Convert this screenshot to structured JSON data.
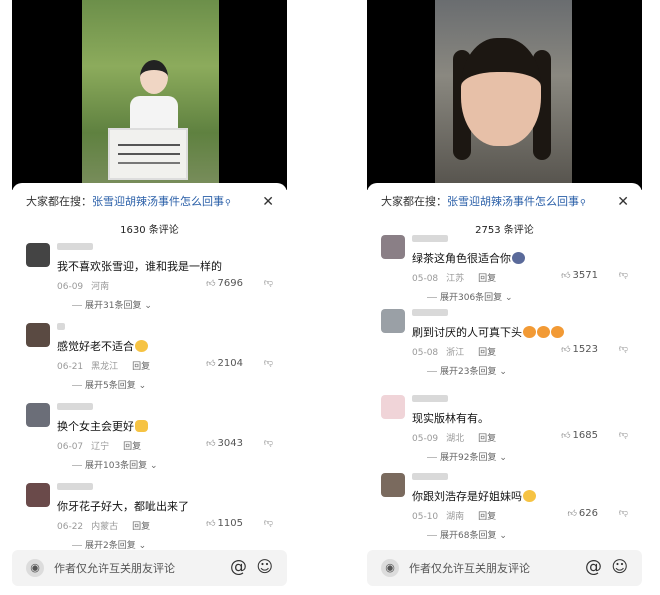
{
  "panels": [
    {
      "search_prefix": "大家都在搜：",
      "search_topic": "张雪迎胡辣汤事件怎么回事",
      "comment_count": "1630 条评论",
      "input_placeholder": "作者仅允许互关朋友评论",
      "comments": [
        {
          "text": "我不喜欢张雪迎，谁和我是一样的",
          "date": "06-09",
          "region": "河南",
          "reply": "",
          "likes": "7696",
          "expand": "展开31条回复",
          "avatar_color": "#444444"
        },
        {
          "text": "感觉好老不适合",
          "date": "06-21",
          "region": "黑龙江",
          "reply": "回复",
          "likes": "2104",
          "expand": "展开5条回复",
          "avatar_color": "#5a4a42"
        },
        {
          "text": "换个女主会更好",
          "date": "06-07",
          "region": "辽宁",
          "reply": "回复",
          "likes": "3043",
          "expand": "展开103条回复",
          "avatar_color": "#6b6e78"
        },
        {
          "text": "你牙花子好大，都呲出来了",
          "date": "06-22",
          "region": "内蒙古",
          "reply": "回复",
          "likes": "1105",
          "expand": "展开2条回复",
          "avatar_color": "#6a4a4a"
        }
      ]
    },
    {
      "search_prefix": "大家都在搜：",
      "search_topic": "张雪迎胡辣汤事件怎么回事",
      "comment_count": "2753 条评论",
      "input_placeholder": "作者仅允许互关朋友评论",
      "comments": [
        {
          "text": "绿茶这角色很适合你",
          "date": "05-08",
          "region": "江苏",
          "reply": "回复",
          "likes": "3571",
          "expand": "展开306条回复",
          "avatar_color": "#8a7f86"
        },
        {
          "text": "刷到讨厌的人可真下头",
          "date": "05-08",
          "region": "浙江",
          "reply": "回复",
          "likes": "1523",
          "expand": "展开23条回复",
          "avatar_color": "#9aa0a6"
        },
        {
          "text": "现实版林有有。",
          "date": "05-09",
          "region": "湖北",
          "reply": "回复",
          "likes": "1685",
          "expand": "展开92条回复",
          "avatar_color": "#f0d4d8"
        },
        {
          "text": "你跟刘浩存是好姐妹吗",
          "date": "05-10",
          "region": "湖南",
          "reply": "回复",
          "likes": "626",
          "expand": "展开68条回复",
          "avatar_color": "#7a6a5e"
        }
      ]
    }
  ]
}
